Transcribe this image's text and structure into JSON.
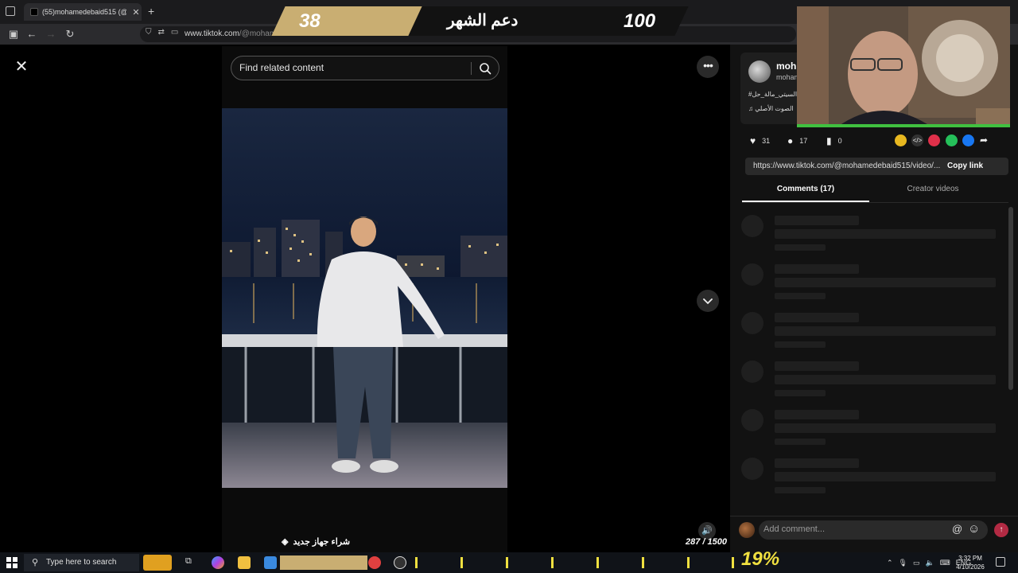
{
  "browser": {
    "tab_title": "(55)mohamedebaid515 (@",
    "tab_close": "✕",
    "new_tab": "+",
    "url_host": "www.tiktok.com",
    "url_path": "/@moham"
  },
  "overlay": {
    "count_left": "38",
    "monthly_support": "دعم الشهر",
    "count_right": "100"
  },
  "viewer": {
    "search_placeholder": "Find related content",
    "buy_device_label": "شراء جهاز جديد",
    "goal_counter": "287 / 1500"
  },
  "author": {
    "name": "moh",
    "handle": "moham",
    "caption": "#السيتي_مالة_حل",
    "sound": "الصوت الأصلي"
  },
  "stats": {
    "likes": "31",
    "comments": "17",
    "saves": "0"
  },
  "share": {
    "link": "https://www.tiktok.com/@mohamedebaid515/video/...",
    "copy_label": "Copy link"
  },
  "tabs": {
    "comments": "Comments (17)",
    "creator": "Creator videos"
  },
  "comment_box": {
    "placeholder": "Add comment..."
  },
  "taskbar": {
    "search_text": "Type here to search",
    "progress_percent": "19%",
    "lang": "ENG",
    "time": "3:32 PM",
    "date": "4/10/2026"
  },
  "colors": {
    "accent_gold": "#c9ae72",
    "accent_yellow": "#f0e040",
    "post_button": "#b22a43",
    "panel_bg": "#121212"
  }
}
